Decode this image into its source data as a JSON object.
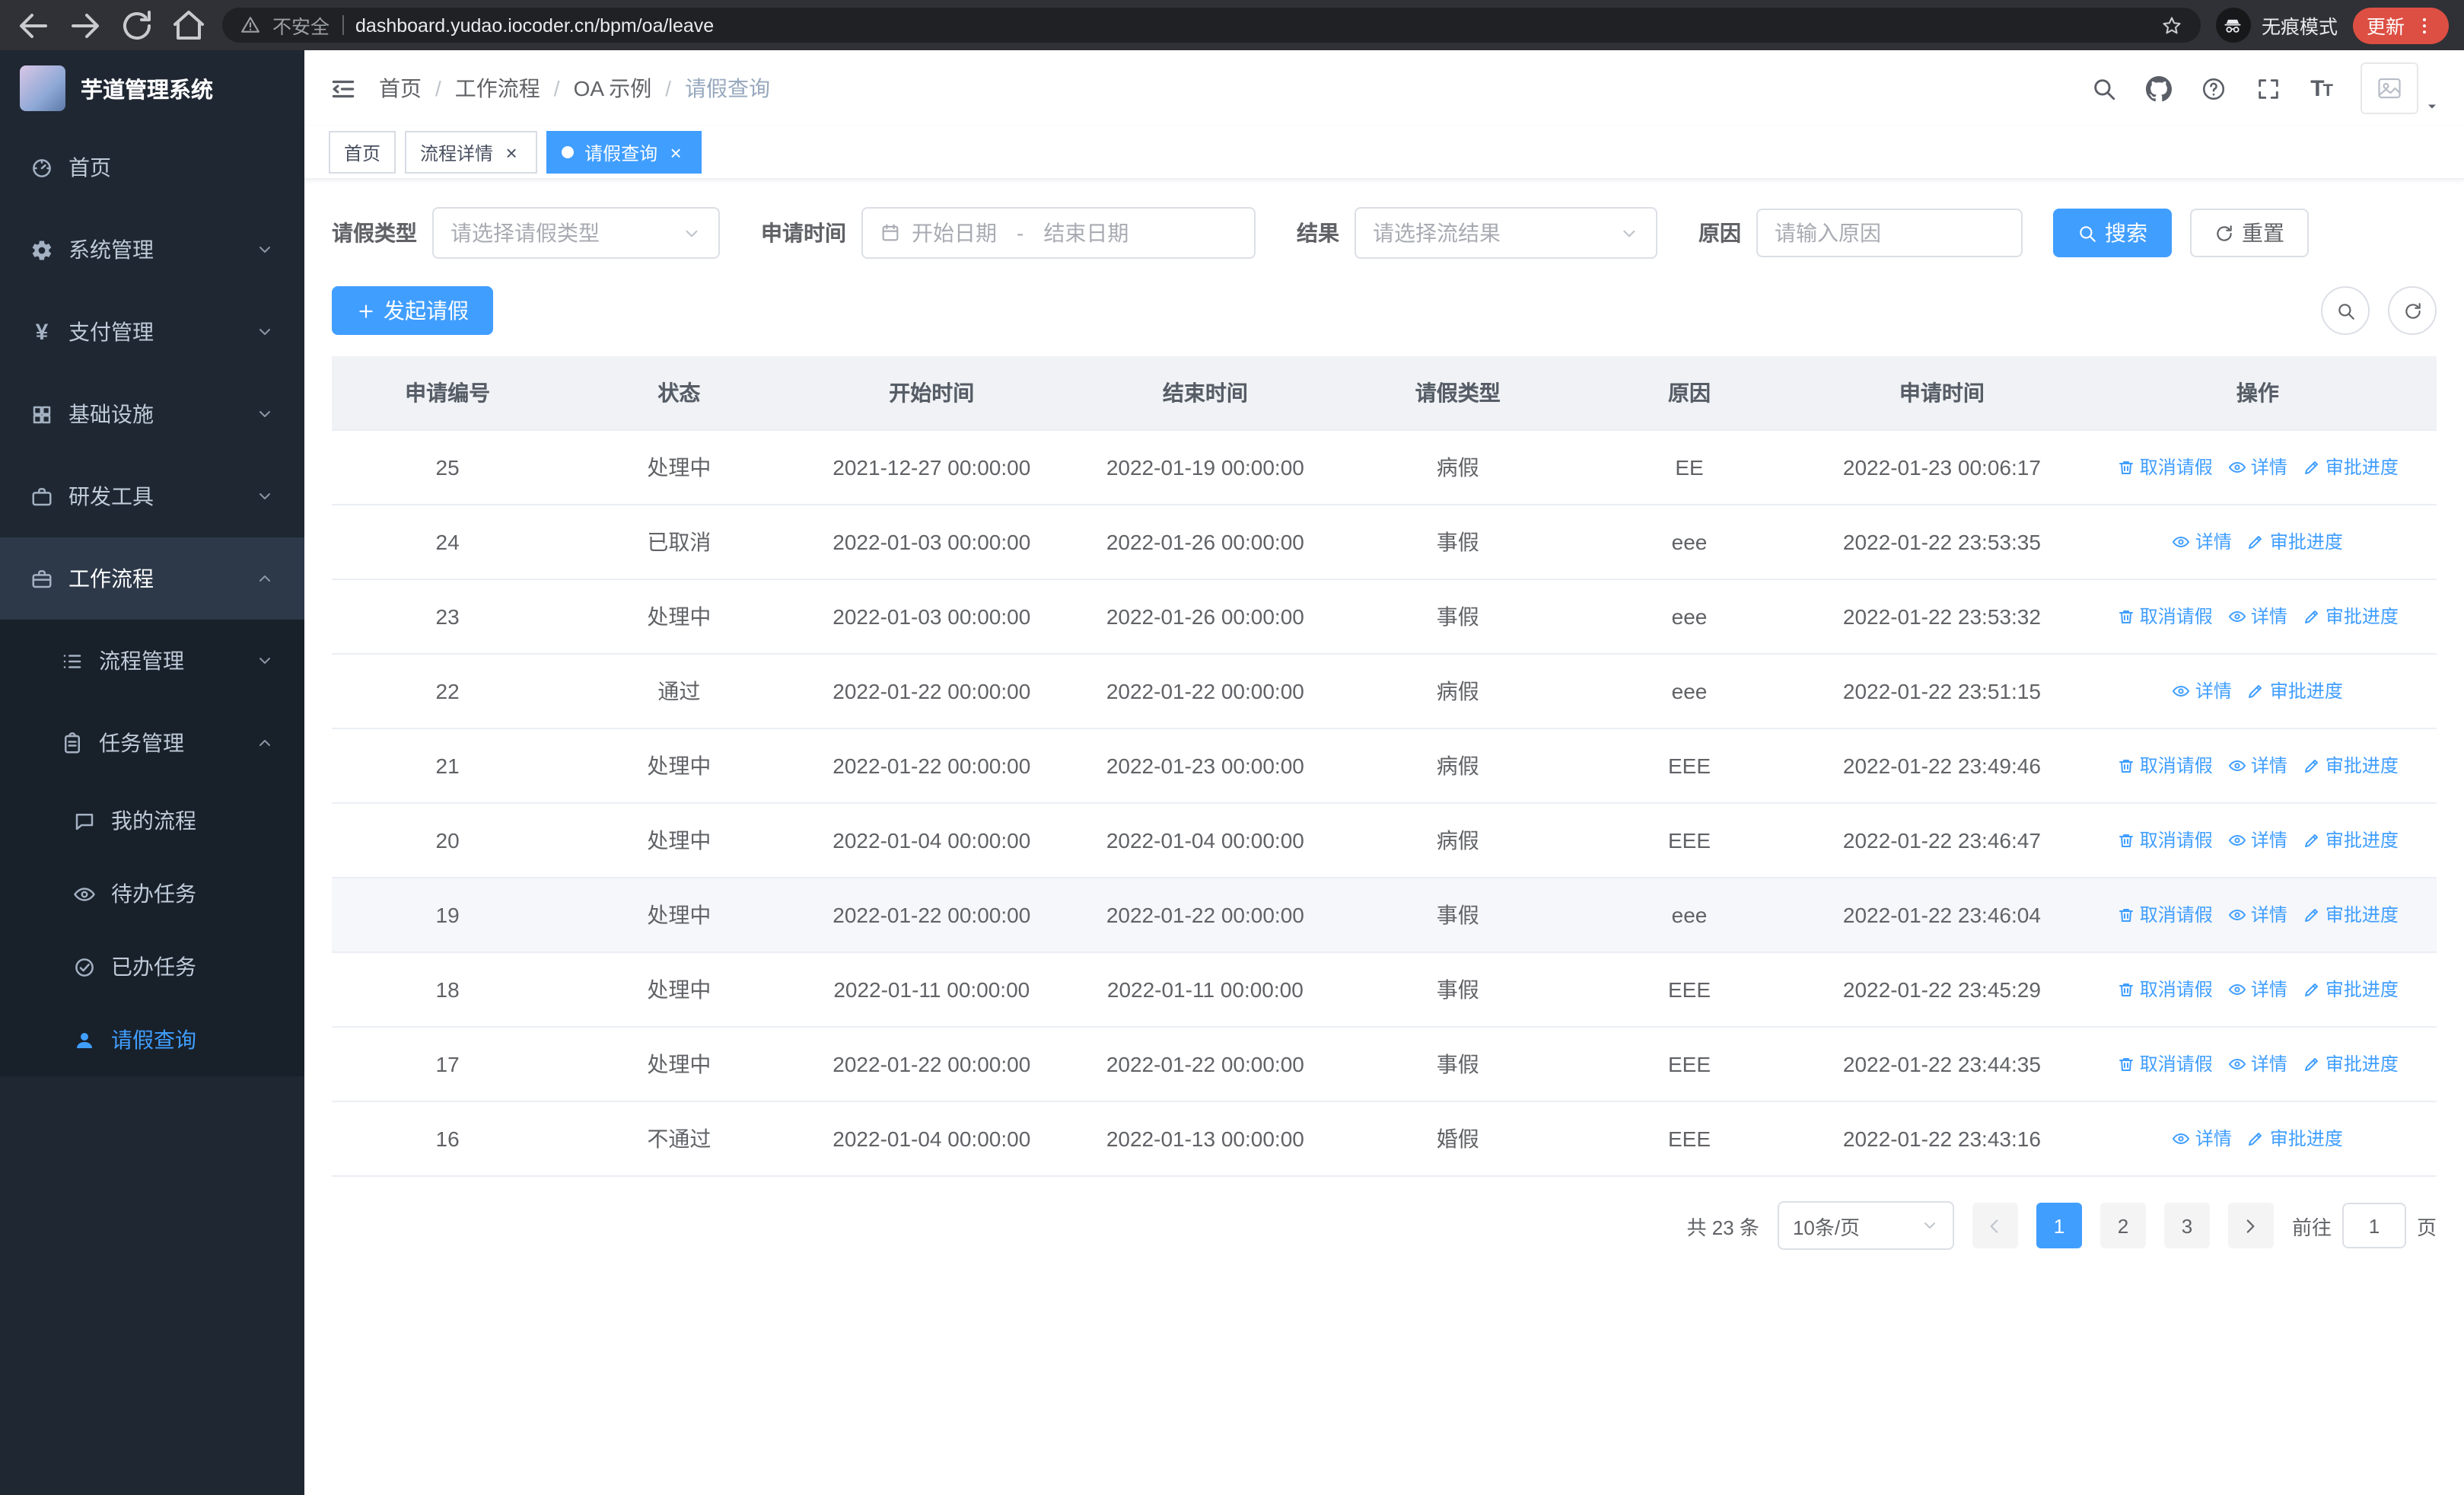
{
  "colors": {
    "primary": "#409eff",
    "sidebar_bg": "#1f2732",
    "chrome_bg": "#2f3136",
    "update_chip": "#dd4f43"
  },
  "browser": {
    "security_warning": "不安全",
    "url": "dashboard.yudao.iocoder.cn/bpm/oa/leave",
    "incognito_label": "无痕模式",
    "update_label": "更新"
  },
  "sidebar": {
    "app_title": "芋道管理系统",
    "items": [
      {
        "label": "首页",
        "icon": "dashboard-icon"
      },
      {
        "label": "系统管理",
        "icon": "gear-icon"
      },
      {
        "label": "支付管理",
        "icon": "yen-icon"
      },
      {
        "label": "基础设施",
        "icon": "grid-icon"
      },
      {
        "label": "研发工具",
        "icon": "briefcase-icon"
      },
      {
        "label": "工作流程",
        "icon": "workflow-icon"
      }
    ],
    "submenu": [
      {
        "label": "流程管理",
        "icon": "list-icon"
      },
      {
        "label": "任务管理",
        "icon": "clipboard-icon"
      }
    ],
    "leaf_items": [
      {
        "label": "我的流程",
        "icon": "chat-icon"
      },
      {
        "label": "待办任务",
        "icon": "eye-icon"
      },
      {
        "label": "已办任务",
        "icon": "done-icon"
      },
      {
        "label": "请假查询",
        "icon": "user-icon",
        "active": true
      }
    ]
  },
  "header": {
    "breadcrumb": [
      "首页",
      "工作流程",
      "OA 示例",
      "请假查询"
    ],
    "separator": "/"
  },
  "tabs": [
    {
      "label": "首页",
      "closable": false,
      "active": false
    },
    {
      "label": "流程详情",
      "closable": true,
      "active": false
    },
    {
      "label": "请假查询",
      "closable": true,
      "active": true
    }
  ],
  "filters": {
    "leave_type_label": "请假类型",
    "leave_type_placeholder": "请选择请假类型",
    "apply_time_label": "申请时间",
    "start_date_placeholder": "开始日期",
    "date_separator": "-",
    "end_date_placeholder": "结束日期",
    "result_label": "结果",
    "result_placeholder": "请选择流结果",
    "reason_label": "原因",
    "reason_placeholder": "请输入原因",
    "search_button": "搜索",
    "reset_button": "重置"
  },
  "toolbar": {
    "create_button": "发起请假"
  },
  "table": {
    "columns": [
      "申请编号",
      "状态",
      "开始时间",
      "结束时间",
      "请假类型",
      "原因",
      "申请时间",
      "操作"
    ],
    "action_defs": {
      "cancel": {
        "label": "取消请假",
        "icon": "trash-icon"
      },
      "detail": {
        "label": "详情",
        "icon": "eye-icon"
      },
      "progress": {
        "label": "审批进度",
        "icon": "pencil-icon"
      }
    },
    "rows": [
      {
        "id": "25",
        "status": "处理中",
        "start": "2021-12-27 00:00:00",
        "end": "2022-01-19 00:00:00",
        "type": "病假",
        "reason": "EE",
        "applied": "2022-01-23 00:06:17",
        "actions": [
          "cancel",
          "detail",
          "progress"
        ]
      },
      {
        "id": "24",
        "status": "已取消",
        "start": "2022-01-03 00:00:00",
        "end": "2022-01-26 00:00:00",
        "type": "事假",
        "reason": "eee",
        "applied": "2022-01-22 23:53:35",
        "actions": [
          "detail",
          "progress"
        ]
      },
      {
        "id": "23",
        "status": "处理中",
        "start": "2022-01-03 00:00:00",
        "end": "2022-01-26 00:00:00",
        "type": "事假",
        "reason": "eee",
        "applied": "2022-01-22 23:53:32",
        "actions": [
          "cancel",
          "detail",
          "progress"
        ]
      },
      {
        "id": "22",
        "status": "通过",
        "start": "2022-01-22 00:00:00",
        "end": "2022-01-22 00:00:00",
        "type": "病假",
        "reason": "eee",
        "applied": "2022-01-22 23:51:15",
        "actions": [
          "detail",
          "progress"
        ]
      },
      {
        "id": "21",
        "status": "处理中",
        "start": "2022-01-22 00:00:00",
        "end": "2022-01-23 00:00:00",
        "type": "病假",
        "reason": "EEE",
        "applied": "2022-01-22 23:49:46",
        "actions": [
          "cancel",
          "detail",
          "progress"
        ]
      },
      {
        "id": "20",
        "status": "处理中",
        "start": "2022-01-04 00:00:00",
        "end": "2022-01-04 00:00:00",
        "type": "病假",
        "reason": "EEE",
        "applied": "2022-01-22 23:46:47",
        "actions": [
          "cancel",
          "detail",
          "progress"
        ]
      },
      {
        "id": "19",
        "status": "处理中",
        "start": "2022-01-22 00:00:00",
        "end": "2022-01-22 00:00:00",
        "type": "事假",
        "reason": "eee",
        "applied": "2022-01-22 23:46:04",
        "actions": [
          "cancel",
          "detail",
          "progress"
        ],
        "highlight": true
      },
      {
        "id": "18",
        "status": "处理中",
        "start": "2022-01-11 00:00:00",
        "end": "2022-01-11 00:00:00",
        "type": "事假",
        "reason": "EEE",
        "applied": "2022-01-22 23:45:29",
        "actions": [
          "cancel",
          "detail",
          "progress"
        ]
      },
      {
        "id": "17",
        "status": "处理中",
        "start": "2022-01-22 00:00:00",
        "end": "2022-01-22 00:00:00",
        "type": "事假",
        "reason": "EEE",
        "applied": "2022-01-22 23:44:35",
        "actions": [
          "cancel",
          "detail",
          "progress"
        ]
      },
      {
        "id": "16",
        "status": "不通过",
        "start": "2022-01-04 00:00:00",
        "end": "2022-01-13 00:00:00",
        "type": "婚假",
        "reason": "EEE",
        "applied": "2022-01-22 23:43:16",
        "actions": [
          "detail",
          "progress"
        ]
      }
    ]
  },
  "pagination": {
    "total_text": "共 23 条",
    "page_size": "10条/页",
    "pages": [
      "1",
      "2",
      "3"
    ],
    "current_page": "1",
    "goto_label": "前往",
    "goto_value": "1",
    "page_suffix": "页"
  }
}
